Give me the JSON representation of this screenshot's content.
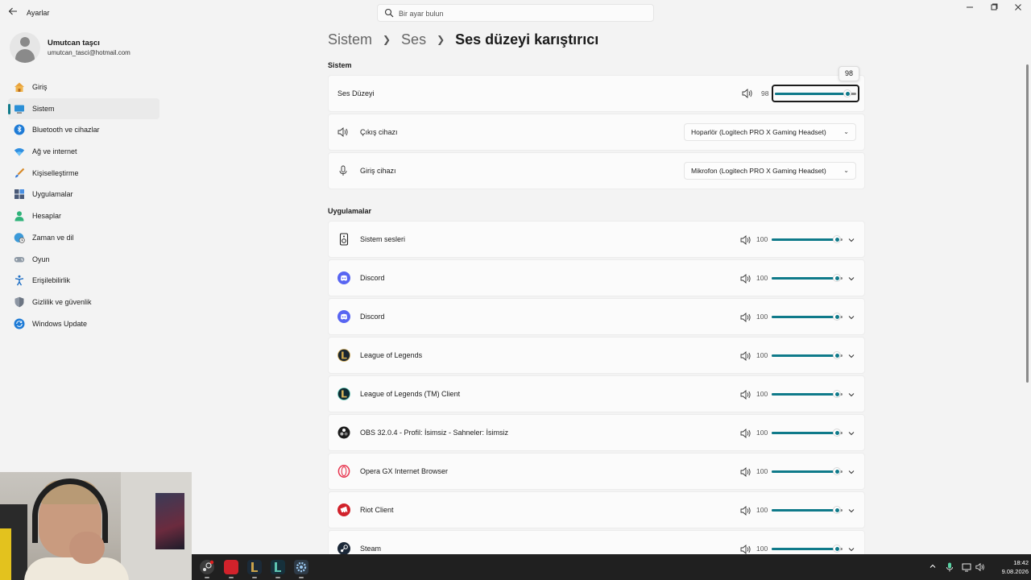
{
  "window": {
    "title": "Ayarlar",
    "back_icon": "arrow-left-icon",
    "controls": [
      "minimize-icon",
      "maximize-icon",
      "close-icon"
    ]
  },
  "search": {
    "placeholder": "Bir ayar bulun",
    "value": ""
  },
  "profile": {
    "name": "Umutcan taşcı",
    "email": "umutcan_tasci@hotmail.com"
  },
  "nav": {
    "active_index": 1,
    "items": [
      {
        "label": "Giriş",
        "icon": "home-icon"
      },
      {
        "label": "Sistem",
        "icon": "system-icon"
      },
      {
        "label": "Bluetooth ve cihazlar",
        "icon": "bluetooth-icon"
      },
      {
        "label": "Ağ ve internet",
        "icon": "wifi-icon"
      },
      {
        "label": "Kişiselleştirme",
        "icon": "brush-icon"
      },
      {
        "label": "Uygulamalar",
        "icon": "apps-icon"
      },
      {
        "label": "Hesaplar",
        "icon": "account-icon"
      },
      {
        "label": "Zaman ve dil",
        "icon": "globe-clock-icon"
      },
      {
        "label": "Oyun",
        "icon": "gamepad-icon"
      },
      {
        "label": "Erişilebilirlik",
        "icon": "accessibility-icon"
      },
      {
        "label": "Gizlilik ve güvenlik",
        "icon": "shield-icon"
      },
      {
        "label": "Windows Update",
        "icon": "update-icon"
      }
    ]
  },
  "breadcrumb": {
    "parts": [
      "Sistem",
      "Ses"
    ],
    "current": "Ses düzeyi karıştırıcı"
  },
  "system_section": {
    "title": "Sistem",
    "volume": {
      "label": "Ses Düzeyi",
      "value": "98",
      "level": 98,
      "tooltip": "98"
    },
    "output": {
      "label": "Çıkış cihazı",
      "value": "Hoparlör (Logitech PRO X Gaming Headset)"
    },
    "input": {
      "label": "Giriş cihazı",
      "value": "Mikrofon (Logitech PRO X Gaming Headset)"
    }
  },
  "apps_section": {
    "title": "Uygulamalar",
    "apps": [
      {
        "name": "Sistem sesleri",
        "volume": "100",
        "level": 100,
        "icon": "speaker-icon"
      },
      {
        "name": "Discord",
        "volume": "100",
        "level": 100,
        "icon": "discord-icon"
      },
      {
        "name": "Discord",
        "volume": "100",
        "level": 100,
        "icon": "discord-icon"
      },
      {
        "name": "League of Legends",
        "volume": "100",
        "level": 100,
        "icon": "league-icon"
      },
      {
        "name": "League of Legends (TM) Client",
        "volume": "100",
        "level": 100,
        "icon": "league-client-icon"
      },
      {
        "name": "OBS 32.0.4 - Profil: İsimsiz - Sahneler: İsimsiz",
        "volume": "100",
        "level": 100,
        "icon": "obs-icon"
      },
      {
        "name": "Opera GX Internet Browser",
        "volume": "100",
        "level": 100,
        "icon": "opera-gx-icon"
      },
      {
        "name": "Riot Client",
        "volume": "100",
        "level": 100,
        "icon": "riot-icon"
      },
      {
        "name": "Steam",
        "volume": "100",
        "level": 100,
        "icon": "steam-icon"
      }
    ]
  },
  "taskbar": {
    "apps": [
      "steam-taskbar-icon",
      "riot-taskbar-icon",
      "league-taskbar-icon",
      "league-client-taskbar-icon",
      "settings-taskbar-icon"
    ],
    "tray": [
      "chevron-up-icon",
      "microphone-icon",
      "display-icon",
      "volume-icon"
    ],
    "time": "18:42",
    "date": "9.08.2026"
  },
  "colors": {
    "accent": "#0f7a8a",
    "background": "#f3f3f3",
    "card": "#fbfbfb",
    "taskbar": "#202020"
  }
}
